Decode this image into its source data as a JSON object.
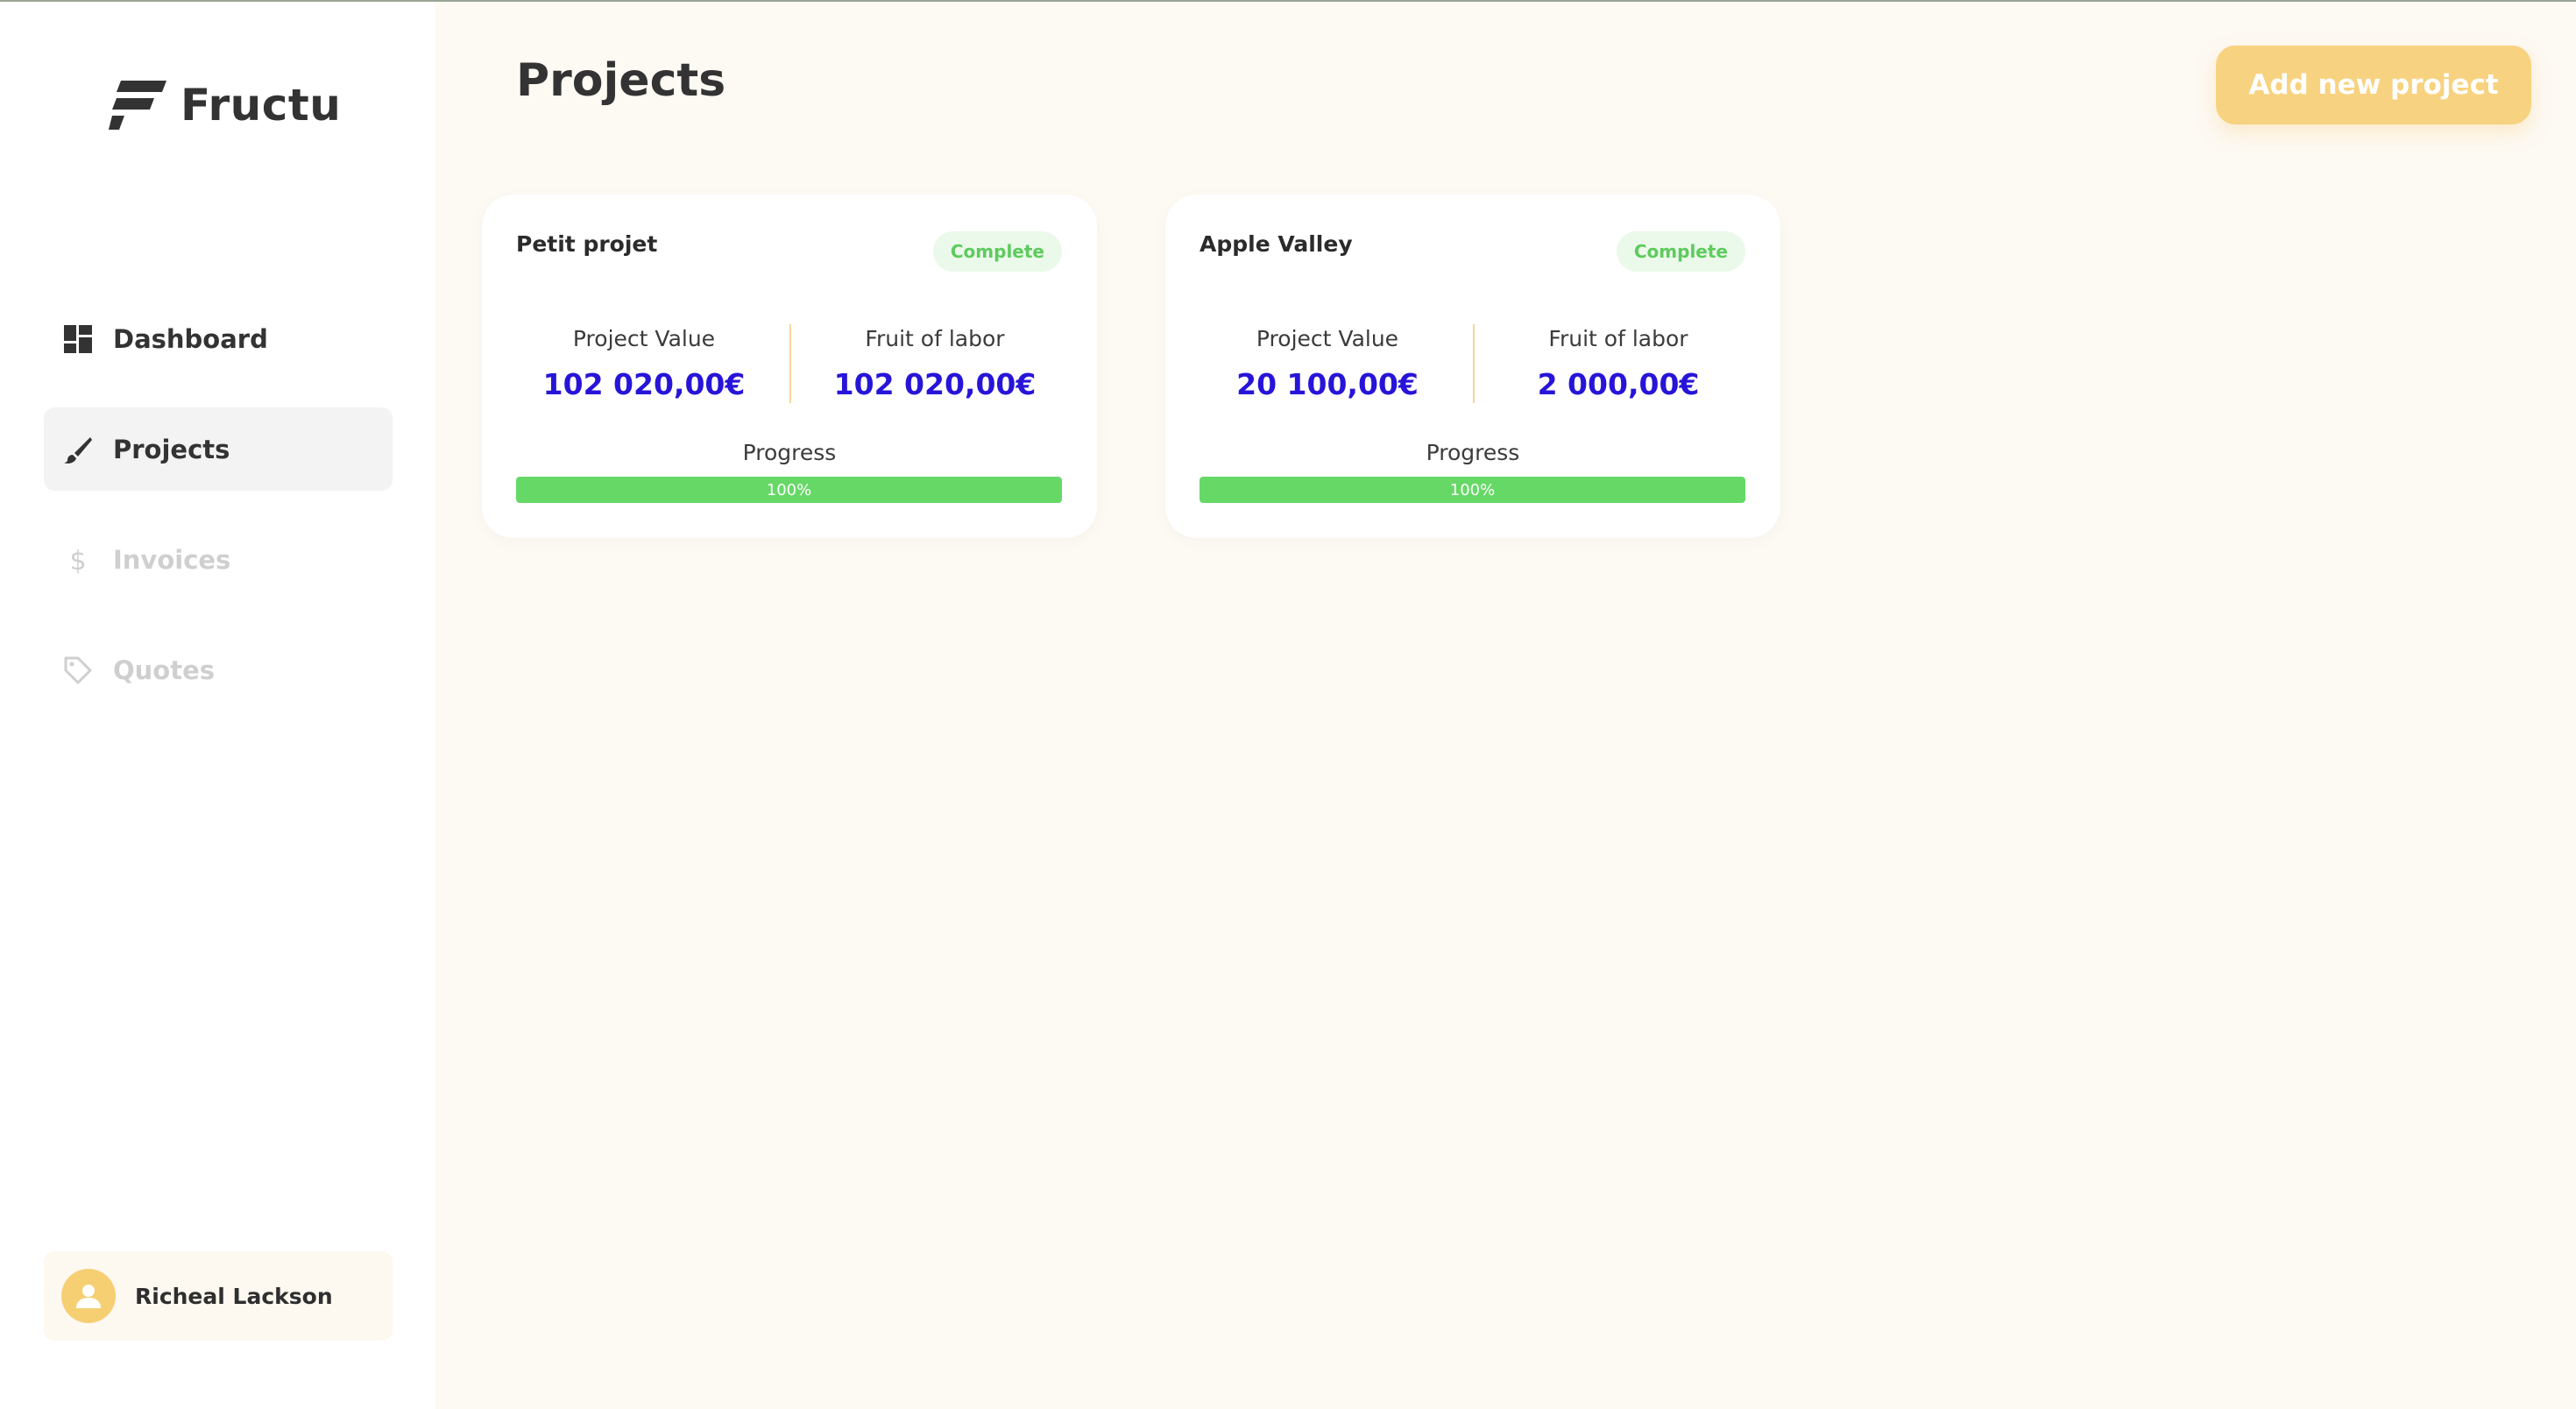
{
  "app": {
    "name": "Fructu"
  },
  "nav": [
    {
      "label": "Dashboard",
      "icon": "dashboard-icon",
      "state": "normal"
    },
    {
      "label": "Projects",
      "icon": "brush-icon",
      "state": "active"
    },
    {
      "label": "Invoices",
      "icon": "dollar-icon",
      "state": "disabled"
    },
    {
      "label": "Quotes",
      "icon": "tag-icon",
      "state": "disabled"
    }
  ],
  "user": {
    "name": "Richeal Lackson",
    "icon": "person-icon"
  },
  "main": {
    "title": "Projects",
    "add_button_label": "Add new project",
    "projects": [
      {
        "name": "Petit projet",
        "status": "Complete",
        "value_label": "Project Value",
        "value": "102 020,00€",
        "fruit_label": "Fruit of labor",
        "fruit": "102 020,00€",
        "progress_label": "Progress",
        "progress_text": "100%",
        "progress": 1.0
      },
      {
        "name": "Apple Valley",
        "status": "Complete",
        "value_label": "Project Value",
        "value": "20 100,00€",
        "fruit_label": "Fruit of labor",
        "fruit": "2 000,00€",
        "progress_label": "Progress",
        "progress_text": "100%",
        "progress": 1.0
      }
    ]
  },
  "colors": {
    "accent": "#f7d280",
    "value_text": "#2714d8",
    "progress": "#66d866",
    "badge_text": "#5dcb5d",
    "background": "#fdf9f3"
  }
}
